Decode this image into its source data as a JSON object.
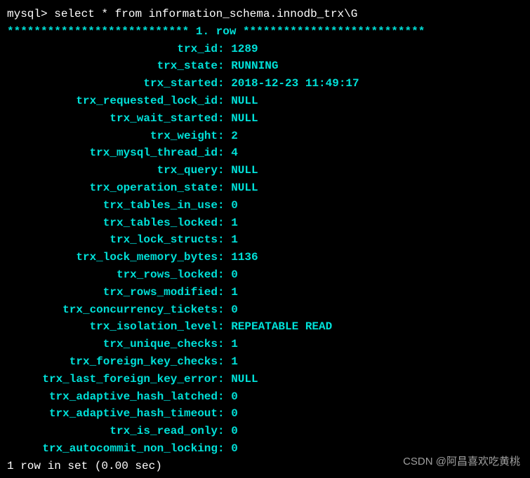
{
  "prompt": "mysql>",
  "query": "select * from information_schema.innodb_trx\\G",
  "row_header": "*************************** 1. row ***************************",
  "fields": [
    {
      "label": "trx_id",
      "value": "1289"
    },
    {
      "label": "trx_state",
      "value": "RUNNING"
    },
    {
      "label": "trx_started",
      "value": "2018-12-23 11:49:17"
    },
    {
      "label": "trx_requested_lock_id",
      "value": "NULL"
    },
    {
      "label": "trx_wait_started",
      "value": "NULL"
    },
    {
      "label": "trx_weight",
      "value": "2"
    },
    {
      "label": "trx_mysql_thread_id",
      "value": "4"
    },
    {
      "label": "trx_query",
      "value": "NULL"
    },
    {
      "label": "trx_operation_state",
      "value": "NULL"
    },
    {
      "label": "trx_tables_in_use",
      "value": "0"
    },
    {
      "label": "trx_tables_locked",
      "value": "1"
    },
    {
      "label": "trx_lock_structs",
      "value": "1"
    },
    {
      "label": "trx_lock_memory_bytes",
      "value": "1136"
    },
    {
      "label": "trx_rows_locked",
      "value": "0"
    },
    {
      "label": "trx_rows_modified",
      "value": "1"
    },
    {
      "label": "trx_concurrency_tickets",
      "value": "0"
    },
    {
      "label": "trx_isolation_level",
      "value": "REPEATABLE READ"
    },
    {
      "label": "trx_unique_checks",
      "value": "1"
    },
    {
      "label": "trx_foreign_key_checks",
      "value": "1"
    },
    {
      "label": "trx_last_foreign_key_error",
      "value": "NULL"
    },
    {
      "label": "trx_adaptive_hash_latched",
      "value": "0"
    },
    {
      "label": "trx_adaptive_hash_timeout",
      "value": "0"
    },
    {
      "label": "trx_is_read_only",
      "value": "0"
    },
    {
      "label": "trx_autocommit_non_locking",
      "value": "0"
    }
  ],
  "footer": "1 row in set (0.00 sec)",
  "watermark": "CSDN @阿昌喜欢吃黄桃"
}
